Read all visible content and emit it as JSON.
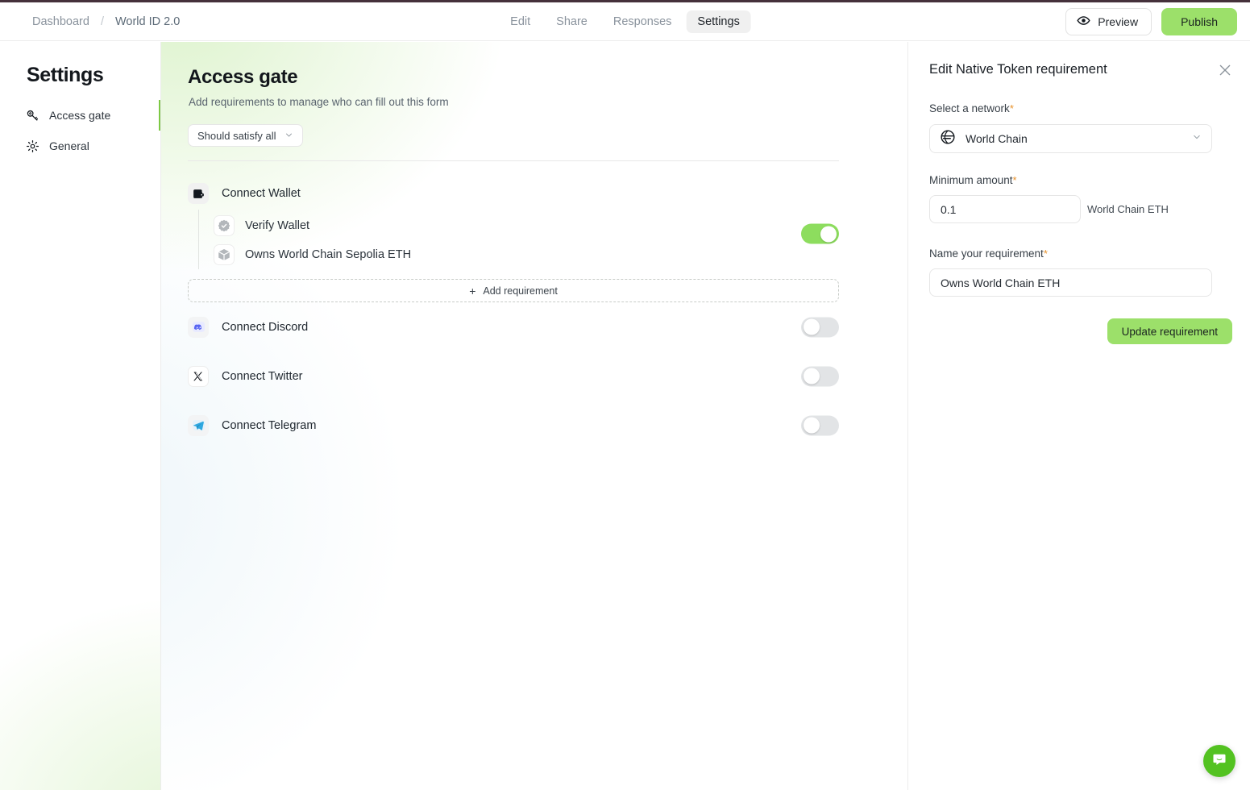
{
  "topbar": {
    "breadcrumb": {
      "root": "Dashboard",
      "separator": "/",
      "current": "World ID 2.0"
    },
    "tabs": [
      {
        "label": "Edit",
        "active": false
      },
      {
        "label": "Share",
        "active": false
      },
      {
        "label": "Responses",
        "active": false
      },
      {
        "label": "Settings",
        "active": true
      }
    ],
    "preview_label": "Preview",
    "publish_label": "Publish",
    "eye_icon": "eye-icon",
    "accent_color": "#9ce06a",
    "accent_bar_color": "#45313b"
  },
  "sidebar": {
    "title": "Settings",
    "items": [
      {
        "label": "Access gate",
        "icon": "key-icon",
        "active": true
      },
      {
        "label": "General",
        "icon": "gear-icon",
        "active": false
      }
    ],
    "active_indicator_color": "#7dc943"
  },
  "main": {
    "title": "Access gate",
    "subtitle": "Add requirements to manage who can fill out this form",
    "satisfy_select": {
      "value": "Should satisfy all",
      "chevron": "chevron-down-icon"
    },
    "add_requirement_label": "Add requirement",
    "wallet_group": {
      "label": "Connect Wallet",
      "icon": "wallet-icon",
      "enabled": true,
      "requirements": [
        {
          "label": "Verify Wallet",
          "icon": "verified-badge-icon"
        },
        {
          "label": "Owns World Chain Sepolia ETH",
          "icon": "cube-icon"
        }
      ]
    },
    "connections": [
      {
        "label": "Connect Discord",
        "icon": "discord-icon",
        "enabled": false
      },
      {
        "label": "Connect Twitter",
        "icon": "twitter-x-icon",
        "enabled": false
      },
      {
        "label": "Connect Telegram",
        "icon": "telegram-icon",
        "enabled": false
      }
    ]
  },
  "panel": {
    "title": "Edit Native Token requirement",
    "close_icon": "close-icon",
    "network_label": "Select a network",
    "network_value": "World Chain",
    "network_icon": "world-chain-icon",
    "amount_label": "Minimum amount",
    "amount_value": "0.1",
    "amount_unit": "World Chain ETH",
    "name_label": "Name your requirement",
    "name_value": "Owns World Chain ETH",
    "update_label": "Update requirement",
    "required_marker": "*"
  },
  "chat": {
    "icon": "chat-bubble-icon",
    "color": "#53c221"
  }
}
